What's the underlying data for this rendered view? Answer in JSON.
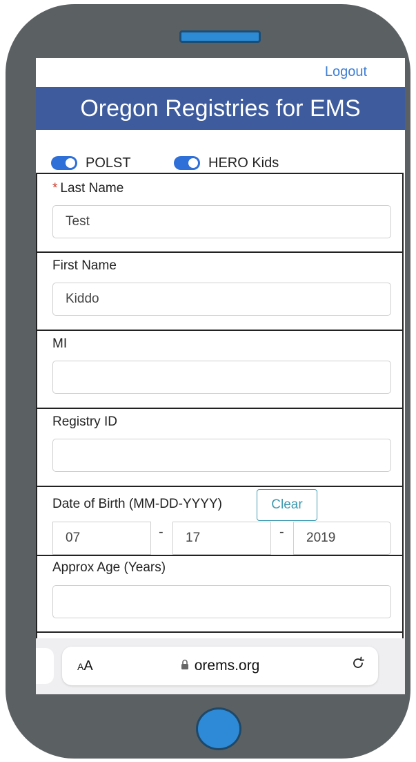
{
  "header": {
    "logout_label": "Logout",
    "title": "Oregon Registries for EMS"
  },
  "toggles": [
    {
      "label": "POLST",
      "on": true
    },
    {
      "label": "HERO Kids",
      "on": true
    }
  ],
  "form": {
    "last_name": {
      "label": "Last Name",
      "required_mark": "*",
      "value": "Test"
    },
    "first_name": {
      "label": "First Name",
      "value": "Kiddo"
    },
    "mi": {
      "label": "MI",
      "value": ""
    },
    "registry_id": {
      "label": "Registry ID",
      "value": ""
    },
    "dob": {
      "label": "Date of Birth (MM-DD-YYYY)",
      "clear_label": "Clear",
      "month": "07",
      "day": "17",
      "year": "2019",
      "separator": "-"
    },
    "approx_age": {
      "label": "Approx Age (Years)",
      "value": ""
    }
  },
  "browser": {
    "text_size_label": "AA",
    "url": "orems.org",
    "lock_icon": "lock-icon",
    "reload_icon": "reload-icon"
  },
  "colors": {
    "banner": "#3d5b9d",
    "accent": "#3d7ed4",
    "phone_frame": "#5b6063"
  }
}
